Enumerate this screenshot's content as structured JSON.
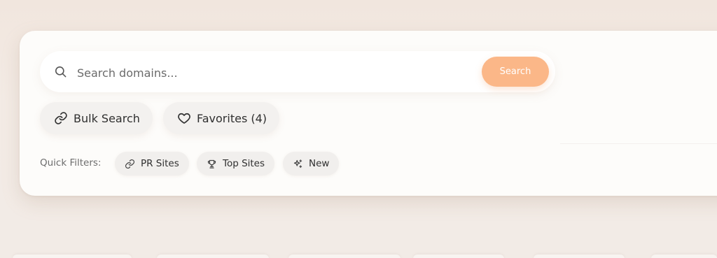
{
  "search": {
    "placeholder": "Search domains...",
    "value": "",
    "button_label": "Search"
  },
  "actions": [
    {
      "label": "Bulk Search",
      "icon": "link-icon"
    },
    {
      "label": "Favorites (4)",
      "icon": "heart-icon"
    }
  ],
  "quick_filters": {
    "label": "Quick Filters:",
    "items": [
      {
        "label": "PR Sites",
        "icon": "link-icon"
      },
      {
        "label": "Top Sites",
        "icon": "trophy-icon"
      },
      {
        "label": "New",
        "icon": "sparkles-icon"
      }
    ]
  },
  "colors": {
    "accent": "#fbb788",
    "panel": "#fdfcfa",
    "background": "#f1e8e1"
  }
}
